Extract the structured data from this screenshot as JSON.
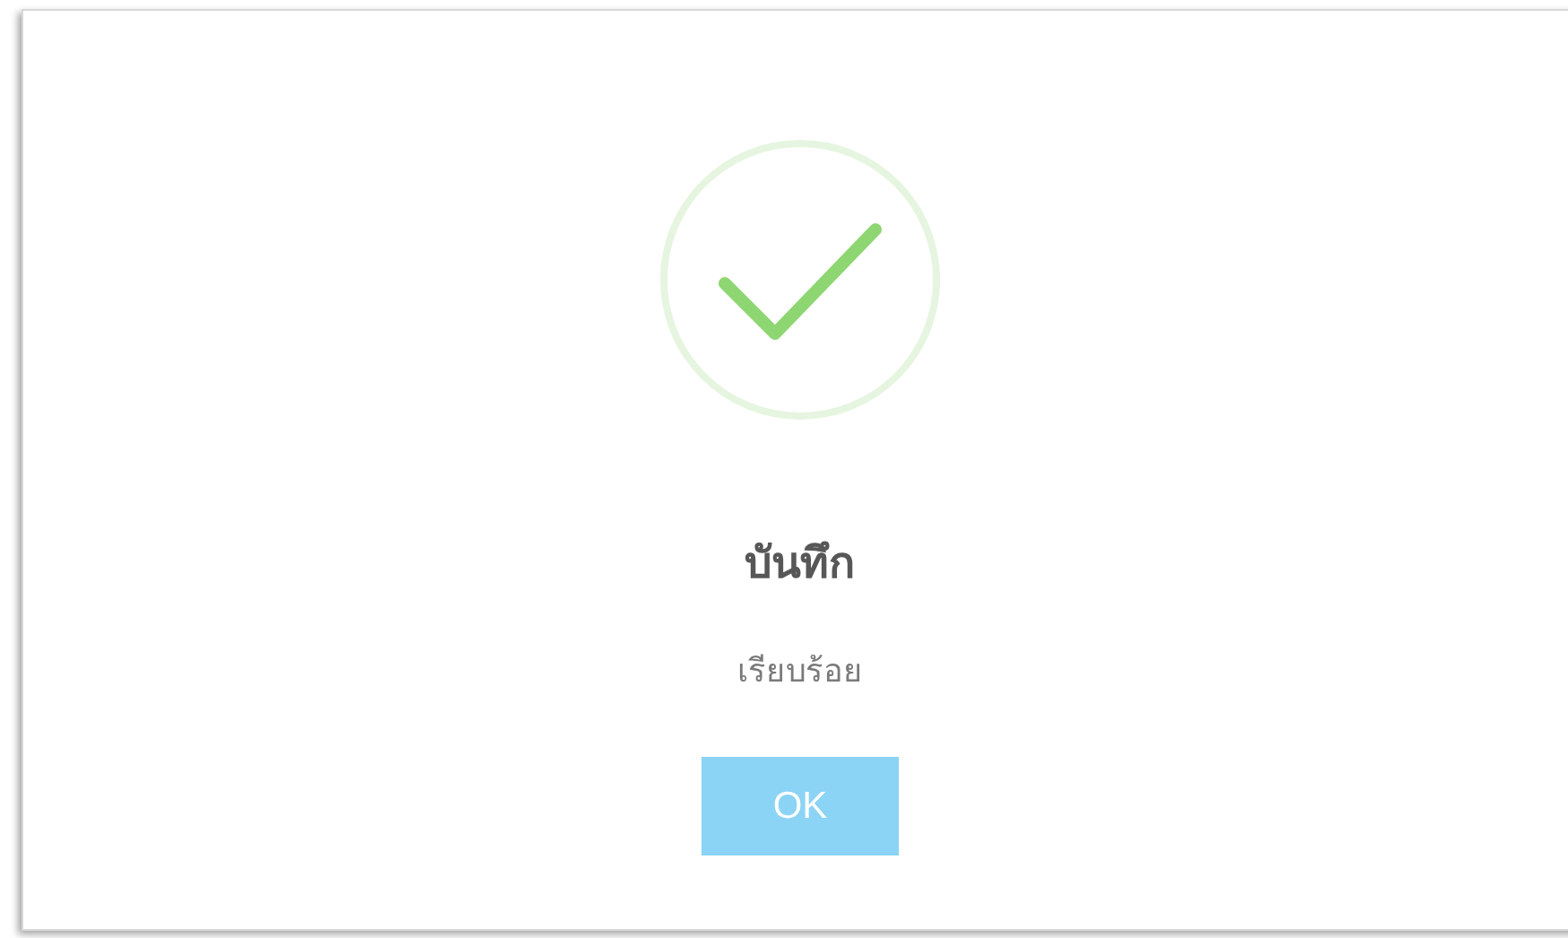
{
  "dialog": {
    "kind": "success",
    "title": "บันทึก",
    "message": "เรียบร้อย",
    "buttons": [
      "OK"
    ]
  }
}
